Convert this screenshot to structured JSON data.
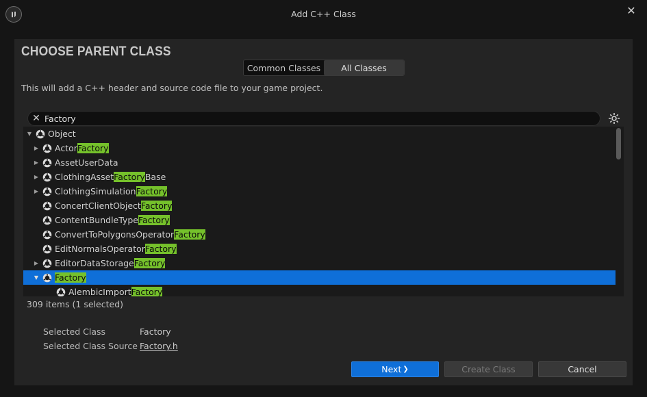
{
  "window": {
    "title": "Add C++ Class",
    "close_glyph": "✕"
  },
  "dialog": {
    "heading": "CHOOSE PARENT CLASS",
    "tabs": [
      {
        "label": "Common Classes",
        "active": false
      },
      {
        "label": "All Classes",
        "active": true
      }
    ],
    "description": "This will add a C++ header and source code file to your game project."
  },
  "search": {
    "value": "Factory",
    "clear_glyph": "✕"
  },
  "tree": {
    "rows": [
      {
        "prefix": "Object",
        "match": "",
        "suffix": "",
        "expander": "expanded"
      },
      {
        "prefix": "Actor",
        "match": "Factory",
        "suffix": "",
        "expander": "collapsed"
      },
      {
        "prefix": "AssetUserData",
        "match": "",
        "suffix": "",
        "expander": "collapsed"
      },
      {
        "prefix": "ClothingAsset",
        "match": "Factory",
        "suffix": "Base",
        "expander": "collapsed"
      },
      {
        "prefix": "ClothingSimulation",
        "match": "Factory",
        "suffix": "",
        "expander": "collapsed"
      },
      {
        "prefix": "ConcertClientObject",
        "match": "Factory",
        "suffix": "",
        "expander": "none"
      },
      {
        "prefix": "ContentBundleType",
        "match": "Factory",
        "suffix": "",
        "expander": "none"
      },
      {
        "prefix": "ConvertToPolygonsOperator",
        "match": "Factory",
        "suffix": "",
        "expander": "none"
      },
      {
        "prefix": "EditNormalsOperator",
        "match": "Factory",
        "suffix": "",
        "expander": "none"
      },
      {
        "prefix": "EditorDataStorage",
        "match": "Factory",
        "suffix": "",
        "expander": "collapsed"
      },
      {
        "prefix": "",
        "match": "Factory",
        "suffix": "",
        "expander": "expanded",
        "selected": true
      },
      {
        "prefix": "AlembicImport",
        "match": "Factory",
        "suffix": "",
        "expander": "none"
      }
    ]
  },
  "status": {
    "count": "309 items (1 selected)"
  },
  "selection": {
    "class_label": "Selected Class",
    "class_value": "Factory",
    "source_label": "Selected Class Source",
    "source_value": "Factory.h"
  },
  "buttons": {
    "next": "Next",
    "next_glyph": "❯",
    "create": "Create Class",
    "cancel": "Cancel"
  },
  "colors": {
    "accent": "#0f6fd8",
    "highlight": "#75c12b",
    "background": "#242424"
  },
  "icons": {
    "logo": "unreal-logo-icon",
    "class": "class-icon",
    "settings": "gear-icon"
  }
}
